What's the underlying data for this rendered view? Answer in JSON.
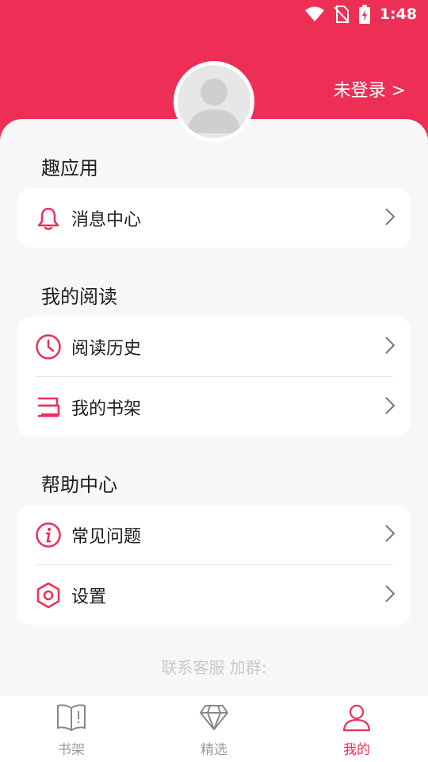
{
  "status_bar": {
    "time": "1:48",
    "icons": [
      "wifi-icon",
      "no-sim-icon",
      "battery-charging-icon"
    ]
  },
  "header": {
    "login_text": "未登录 >",
    "avatar": "default-avatar"
  },
  "sections": [
    {
      "title": "趣应用",
      "items": [
        {
          "label": "消息中心",
          "icon": "bell-icon"
        }
      ]
    },
    {
      "title": "我的阅读",
      "items": [
        {
          "label": "阅读历史",
          "icon": "clock-icon"
        },
        {
          "label": "我的书架",
          "icon": "bookshelf-icon"
        }
      ]
    },
    {
      "title": "帮助中心",
      "items": [
        {
          "label": "常见问题",
          "icon": "info-icon"
        },
        {
          "label": "设置",
          "icon": "settings-hexagon-icon"
        }
      ]
    }
  ],
  "footer": {
    "contact_text": "联系客服  加群:"
  },
  "tabbar": {
    "tabs": [
      {
        "label": "书架",
        "icon": "book-icon",
        "active": false
      },
      {
        "label": "精选",
        "icon": "diamond-icon",
        "active": false
      },
      {
        "label": "我的",
        "icon": "user-icon",
        "active": true
      }
    ]
  },
  "colors": {
    "brand": "#ee2f55",
    "background": "#f7f7f7",
    "card": "#ffffff",
    "text": "#1e1e1e",
    "muted": "#9a9a9a"
  }
}
